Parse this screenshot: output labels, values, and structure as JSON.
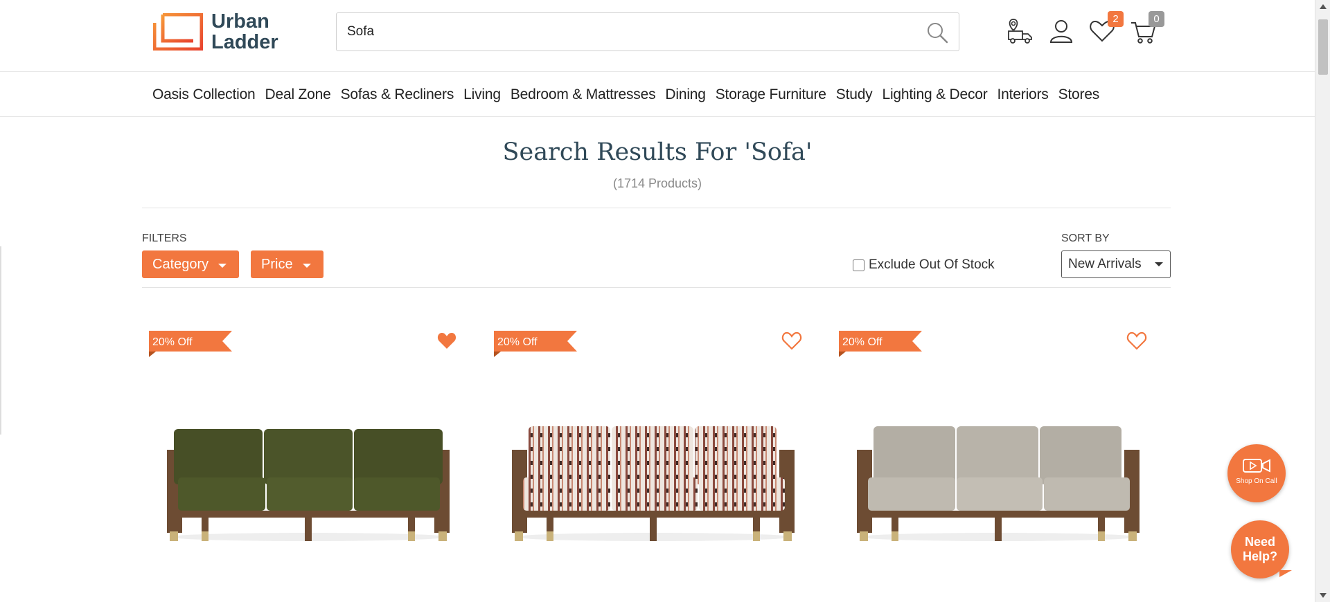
{
  "brand": {
    "line1": "Urban",
    "line2": "Ladder",
    "accent": "#f2773f",
    "text_color": "#304958"
  },
  "search": {
    "value": "Sofa",
    "icon": "search-icon"
  },
  "header_icons": {
    "track": "delivery-truck-location-icon",
    "account": "user-icon",
    "wishlist": {
      "icon": "heart-icon",
      "count": "2"
    },
    "cart": {
      "icon": "cart-icon",
      "count": "0"
    }
  },
  "nav": {
    "items": [
      "Oasis Collection",
      "Deal Zone",
      "Sofas & Recliners",
      "Living",
      "Bedroom & Mattresses",
      "Dining",
      "Storage Furniture",
      "Study",
      "Lighting & Decor",
      "Interiors",
      "Stores"
    ]
  },
  "results": {
    "title_prefix": "Search Results For ",
    "query": "'Sofa'",
    "count": "(1714 Products)"
  },
  "filters": {
    "label": "FILTERS",
    "category": "Category",
    "price": "Price",
    "exclude_label": "Exclude Out Of Stock",
    "exclude_checked": false
  },
  "sort": {
    "label": "SORT BY",
    "selected": "New Arrivals"
  },
  "products": [
    {
      "discount": "20% Off",
      "wishlisted": true,
      "upholstery": "olive velvet"
    },
    {
      "discount": "20% Off",
      "wishlisted": false,
      "upholstery": "patterned fabric"
    },
    {
      "discount": "20% Off",
      "wishlisted": false,
      "upholstery": "grey fabric"
    }
  ],
  "floating": {
    "call": "Shop On Call",
    "help_line1": "Need",
    "help_line2": "Help?"
  }
}
